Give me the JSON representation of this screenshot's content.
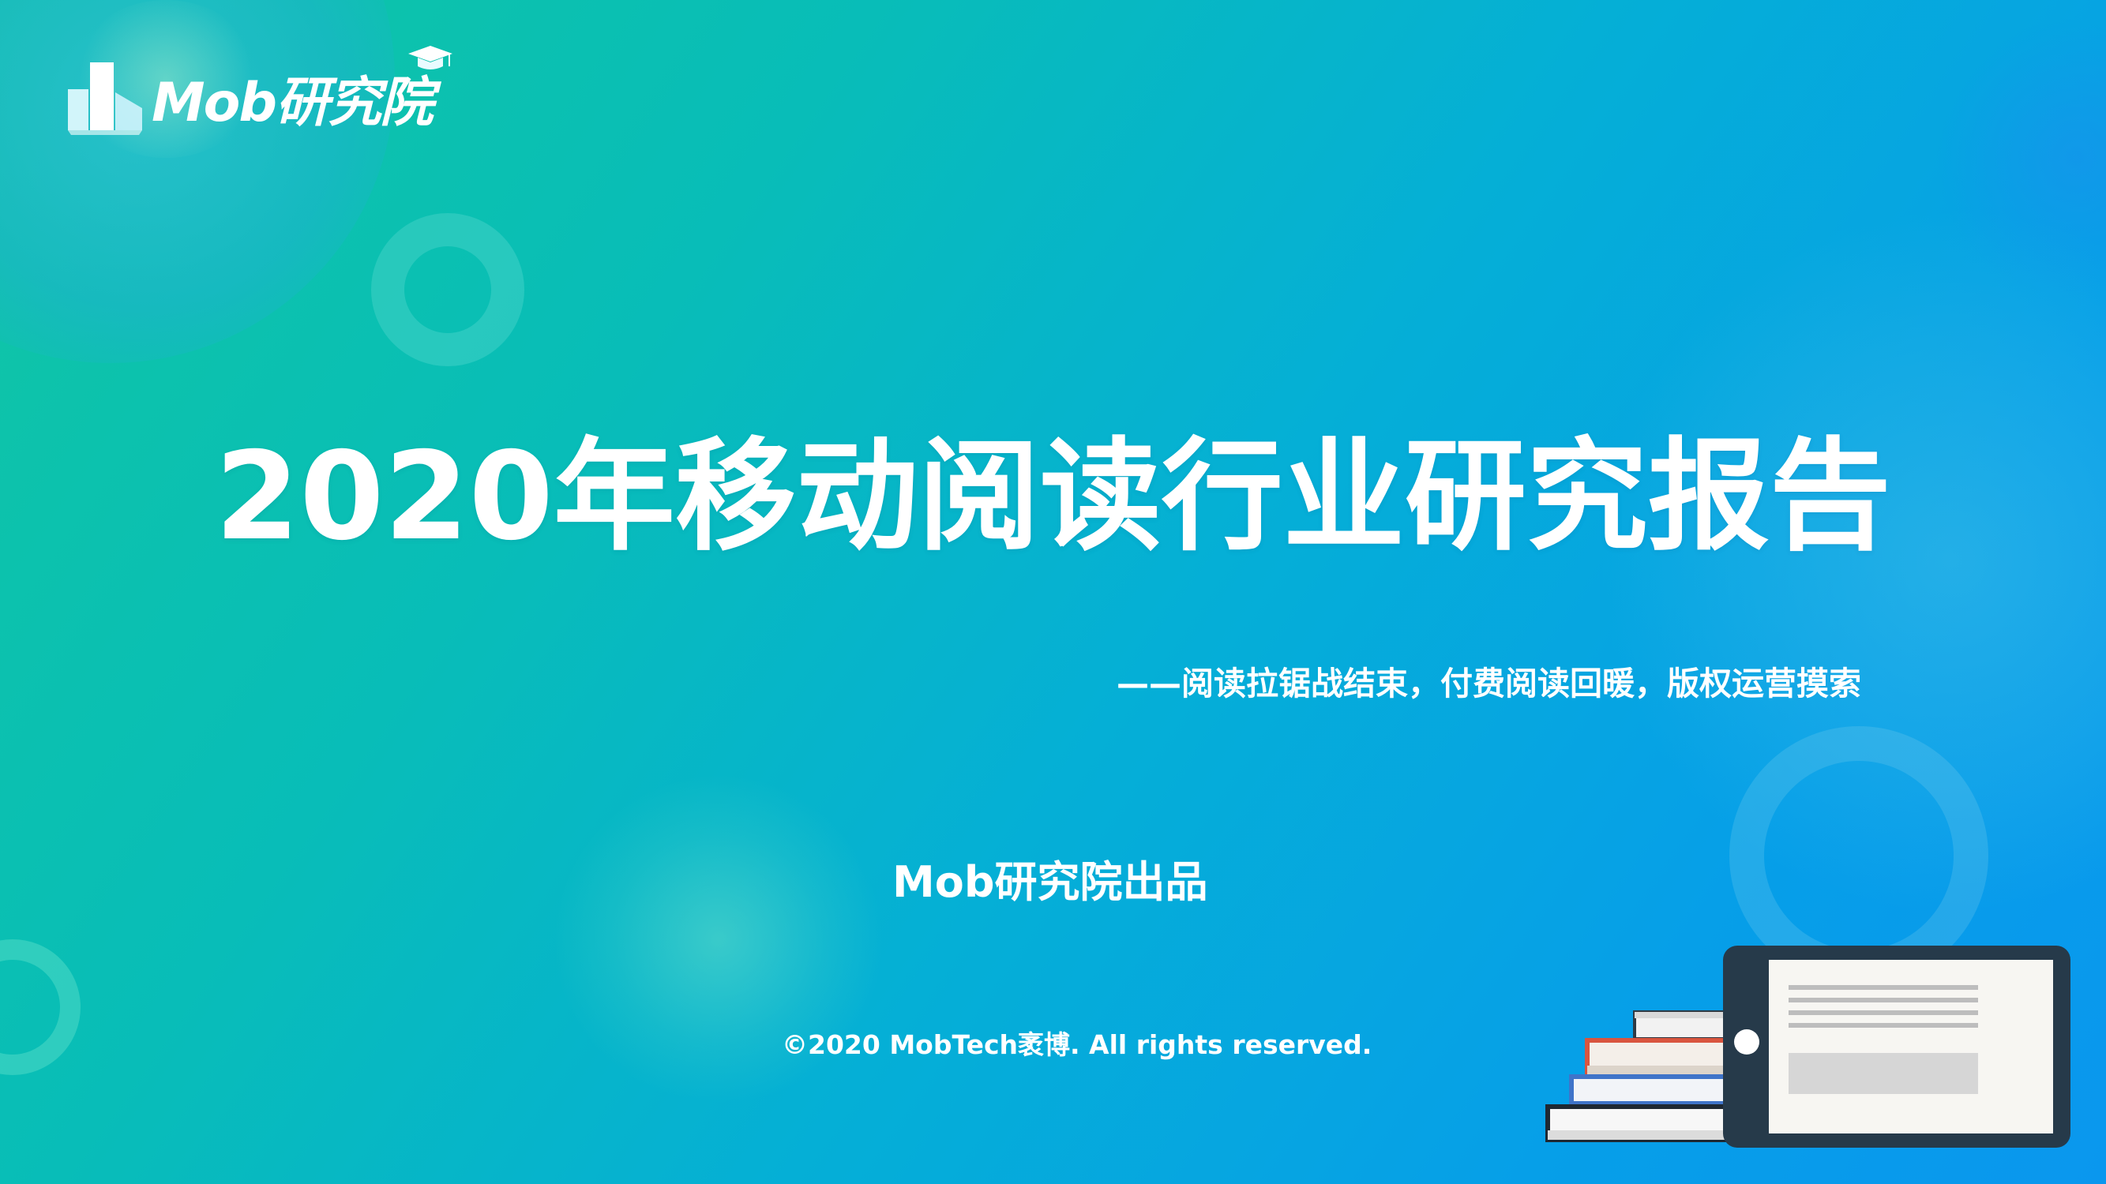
{
  "brand": {
    "logo_text": "Mob研究院",
    "logo_icon": "building-icon",
    "cap_icon": "graduation-cap-icon"
  },
  "cover": {
    "title": "2020年移动阅读行业研究报告",
    "subtitle": "——阅读拉锯战结束，付费阅读回暖，版权运营摸索",
    "producer": "Mob研究院出品",
    "copyright": "©2020 MobTech袤博. All rights reserved."
  },
  "illustration": {
    "icon": "tablet-and-books-icon"
  },
  "colors": {
    "background_start": "#10c6a4",
    "background_end": "#0a97ee",
    "text": "#ffffff",
    "tablet_frame": "#263a4a",
    "book_red": "#d9553f",
    "book_blue": "#3f74c9"
  }
}
